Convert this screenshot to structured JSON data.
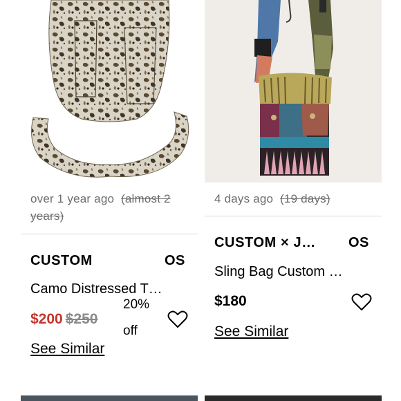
{
  "listings": [
    {
      "time_ago": "over 1 year ago",
      "original_time": "(almost 2 years)",
      "designer": "CUSTOM",
      "size": "OS",
      "title": "Camo Distressed T…",
      "price": "$200",
      "original_price": "$250",
      "discount": "20% off",
      "see_similar": "See Similar",
      "image_icon": "camo-bag-photo"
    },
    {
      "time_ago": "4 days ago",
      "original_time": "(19 days)",
      "designer": "CUSTOM × J…",
      "size": "OS",
      "title": "Sling Bag Custom …",
      "price": "$180",
      "see_similar": "See Similar",
      "image_icon": "patchwork-sling-bag-photo"
    }
  ],
  "colors": {
    "sale_price": "#c3352e",
    "muted_text": "#6d6d6d",
    "divider": "#d9d9d9"
  }
}
